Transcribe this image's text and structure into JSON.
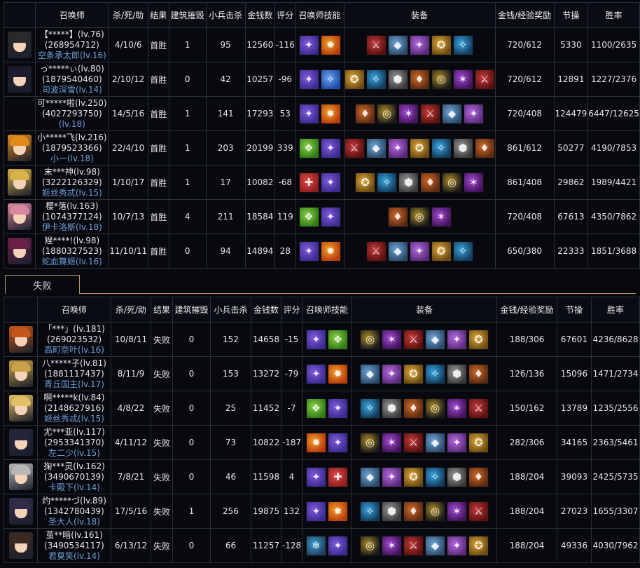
{
  "headers_win": [
    "召唤师",
    "杀/死/助",
    "结果",
    "建筑摧毁",
    "小兵击杀",
    "金钱数",
    "评分",
    "召唤师技能",
    "装备",
    "金钱/经验奖励",
    "节操",
    "胜率"
  ],
  "headers_loss": [
    "召唤师",
    "杀/死/助",
    "结果",
    "建筑摧毁",
    "小兵击杀",
    "金钱数",
    "评分",
    "召唤师技能",
    "装备",
    "金钱/经验奖励",
    "节操",
    "胜率"
  ],
  "loss_tab_label": "失败",
  "win_rows": [
    {
      "name": "【*****】(lv.76)",
      "id": "(268954712)",
      "hero": "空条承太郎(lv.16)",
      "kda": "4/10/6",
      "result": "首胜",
      "towers": "1",
      "cs": "95",
      "gold": "12560",
      "score": "-116",
      "reward": "720/612",
      "jiecao": "5330",
      "winrate": "1100/2635"
    },
    {
      "name": "っ*****ぃ(lv.80)",
      "id": "(1879540460)",
      "hero": "司波深雪(lv.14)",
      "kda": "2/10/12",
      "result": "首胜",
      "towers": "0",
      "cs": "42",
      "gold": "10257",
      "score": "-96",
      "reward": "720/612",
      "jiecao": "12891",
      "winrate": "1227/2376"
    },
    {
      "name": "可*****啦(lv.250)",
      "id": "(4027293750)",
      "hero": "(lv.18)",
      "kda": "14/5/16",
      "result": "首胜",
      "towers": "1",
      "cs": "141",
      "gold": "17293",
      "score": "53",
      "reward": "720/408",
      "jiecao": "124479",
      "winrate": "6447/12625"
    },
    {
      "name": "小*****飞(lv.216)",
      "id": "(1879523366)",
      "hero": "小一(lv.18)",
      "kda": "22/4/10",
      "result": "首胜",
      "towers": "1",
      "cs": "203",
      "gold": "20199",
      "score": "339",
      "reward": "861/612",
      "jiecao": "50277",
      "winrate": "4190/7853"
    },
    {
      "name": "末***神(lv.98)",
      "id": "(3222126329)",
      "hero": "姬丝秀忒(lv.15)",
      "kda": "1/10/17",
      "result": "首胜",
      "towers": "1",
      "cs": "17",
      "gold": "10082",
      "score": "-68",
      "reward": "861/408",
      "jiecao": "29862",
      "winrate": "1989/4421"
    },
    {
      "name": "樱*落(lv.163)",
      "id": "(1074377124)",
      "hero": "伊卡洛斯(lv.18)",
      "kda": "10/7/13",
      "result": "首胜",
      "towers": "4",
      "cs": "211",
      "gold": "18584",
      "score": "119",
      "reward": "720/408",
      "jiecao": "67613",
      "winrate": "4350/7862"
    },
    {
      "name": "矬****!(lv.98)",
      "id": "(1880327523)",
      "hero": "蛇血舞姬(lv.16)",
      "kda": "11/10/11",
      "result": "首胜",
      "towers": "0",
      "cs": "94",
      "gold": "14894",
      "score": "28",
      "reward": "650/380",
      "jiecao": "22333",
      "winrate": "1851/3688"
    }
  ],
  "loss_rows": [
    {
      "name": "「***」(lv.181)",
      "id": "(269023532)",
      "hero": "高町奈叶(lv.16)",
      "kda": "10/8/11",
      "result": "失败",
      "towers": "0",
      "cs": "152",
      "gold": "14658",
      "score": "-15",
      "reward": "188/306",
      "jiecao": "67601",
      "winrate": "4236/8628"
    },
    {
      "name": "八*****子(lv.81)",
      "id": "(1881117437)",
      "hero": "青丘国主(lv.17)",
      "kda": "8/11/9",
      "result": "失败",
      "towers": "0",
      "cs": "153",
      "gold": "13272",
      "score": "-79",
      "reward": "126/136",
      "jiecao": "15096",
      "winrate": "1471/2734"
    },
    {
      "name": "啊*****k(lv.84)",
      "id": "(2148627916)",
      "hero": "姬丝秀忒(lv.15)",
      "kda": "4/8/22",
      "result": "失败",
      "towers": "0",
      "cs": "25",
      "gold": "11452",
      "score": "-7",
      "reward": "150/162",
      "jiecao": "13789",
      "winrate": "1235/2556"
    },
    {
      "name": "尤***亚(lv.117)",
      "id": "(2953341370)",
      "hero": "左二少(lv.15)",
      "kda": "4/11/12",
      "result": "失败",
      "towers": "0",
      "cs": "73",
      "gold": "10822",
      "score": "-187",
      "reward": "282/306",
      "jiecao": "34165",
      "winrate": "2363/5461"
    },
    {
      "name": "掬***灵(lv.162)",
      "id": "(3490670139)",
      "hero": "卡殿下(lv.14)",
      "kda": "7/8/21",
      "result": "失败",
      "towers": "0",
      "cs": "46",
      "gold": "11598",
      "score": "4",
      "reward": "188/204",
      "jiecao": "39093",
      "winrate": "2425/5735"
    },
    {
      "name": "灼*****づ(lv.89)",
      "id": "(1342780439)",
      "hero": "圣大人(lv.18)",
      "kda": "17/5/16",
      "result": "失败",
      "towers": "1",
      "cs": "256",
      "gold": "19875",
      "score": "132",
      "reward": "188/204",
      "jiecao": "27023",
      "winrate": "1655/3307"
    },
    {
      "name": "茧**暗(lv.161)",
      "id": "(3490534117)",
      "hero": "君莫笑(lv.14)",
      "kda": "6/13/12",
      "result": "失败",
      "towers": "0",
      "cs": "66",
      "gold": "11257",
      "score": "-128",
      "reward": "188/204",
      "jiecao": "49336",
      "winrate": "4030/7962"
    }
  ],
  "colors": {
    "background": "#07090f",
    "grid": "#2b2f38",
    "hero_name": "#6f9fd8",
    "tab_border": "#b89a58"
  },
  "icon_names": {
    "avatar": "player-avatar-icon",
    "skills": [
      "flash-spell-icon",
      "ignite-spell-icon",
      "teleport-spell-icon",
      "smite-spell-icon",
      "heal-spell-icon",
      "exhaust-spell-icon"
    ],
    "items": "equipment-item-icon"
  }
}
